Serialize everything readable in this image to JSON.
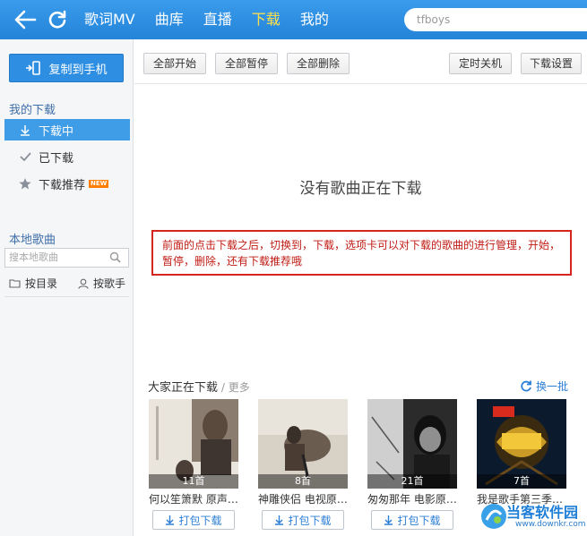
{
  "header": {
    "nav": [
      "歌词MV",
      "曲库",
      "直播",
      "下载",
      "我的"
    ],
    "active_nav": "下载",
    "search_value": "tfboys"
  },
  "sidebar": {
    "copy_button": "复制到手机",
    "my_downloads_title": "我的下载",
    "items": [
      {
        "label": "下载中",
        "active": true
      },
      {
        "label": "已下载",
        "active": false
      },
      {
        "label": "下载推荐",
        "badge": "NEW",
        "active": false
      }
    ],
    "local_title": "本地歌曲",
    "local_search_placeholder": "搜本地歌曲",
    "by_folder": "按目录",
    "by_singer": "按歌手"
  },
  "toolbar": {
    "start_all": "全部开始",
    "pause_all": "全部暂停",
    "delete_all": "全部删除",
    "timer_shutdown": "定时关机",
    "download_settings": "下载设置"
  },
  "main": {
    "empty_message": "没有歌曲正在下载",
    "annotation": "前面的点击下载之后，切换到，下载，选项卡可以对下载的歌曲的进行管理，开始，暂停，删除，还有下载推荐哦",
    "section_title": "大家正在下载",
    "section_more": "更多",
    "refresh_label": "换一批",
    "pack_label": "打包下载",
    "cards": [
      {
        "name": "何以笙箫默 原声…",
        "count": "11首"
      },
      {
        "name": "神雕侠侣 电视原…",
        "count": "8首"
      },
      {
        "name": "匆匆那年 电影原…",
        "count": "21首"
      },
      {
        "name": "我是歌手第三季…",
        "count": "7首"
      }
    ]
  },
  "watermark": {
    "text": "当客软件园",
    "url": "www.downkr.com"
  },
  "colors": {
    "primary": "#2e8fe2",
    "active_nav": "#ffe04a",
    "annotation_red": "#d4251f"
  }
}
